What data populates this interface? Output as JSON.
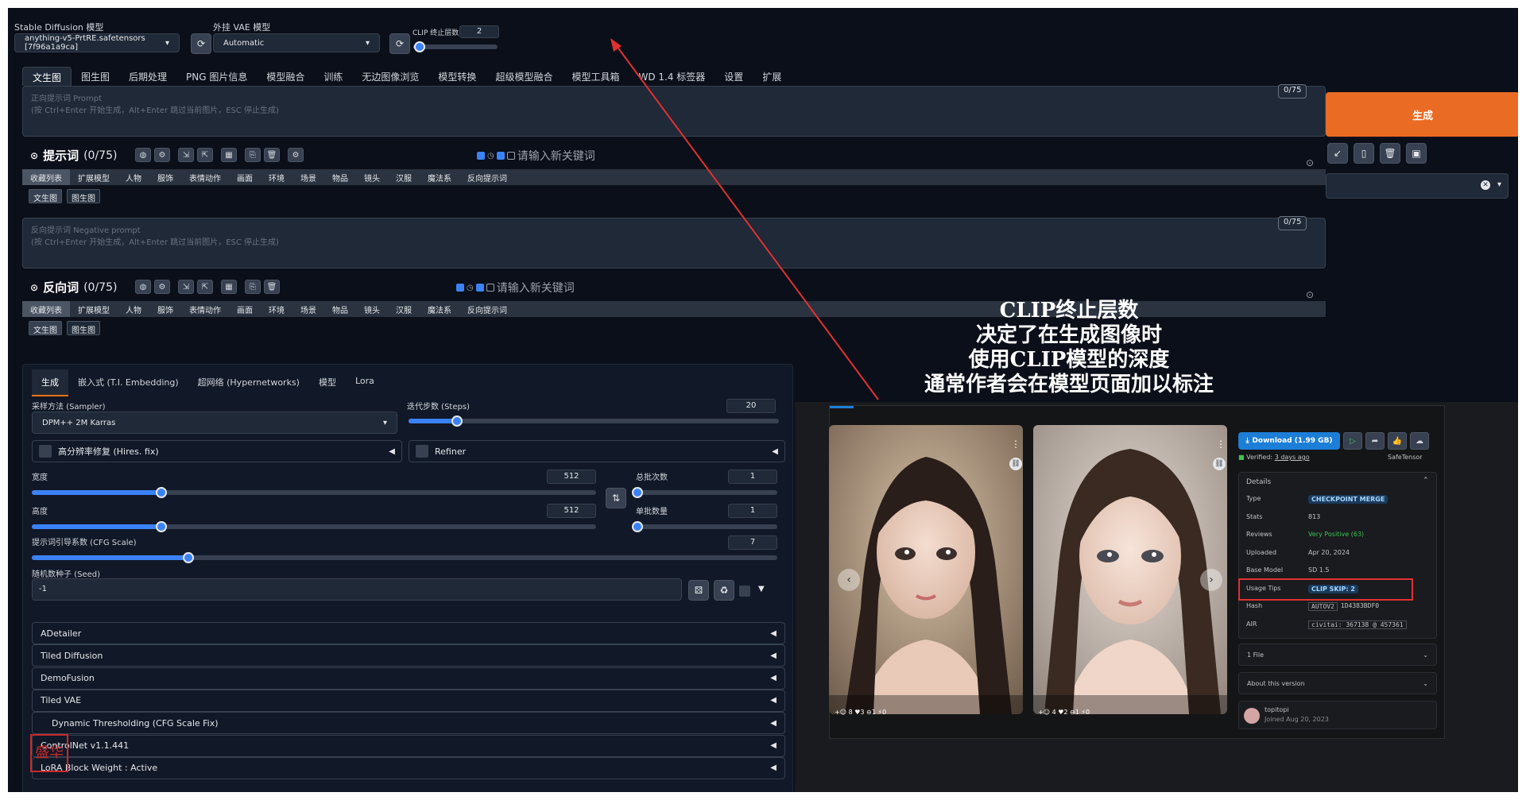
{
  "header": {
    "sd_model_label": "Stable Diffusion 模型",
    "sd_model_value": "anything-v5-PrtRE.safetensors [7f96a1a9ca]",
    "vae_label": "外挂 VAE 模型",
    "vae_value": "Automatic",
    "clip_label": "CLIP 终止层数",
    "clip_value": "2",
    "clip_fraction": 0.08
  },
  "main_tabs": [
    "文生图",
    "图生图",
    "后期处理",
    "PNG 图片信息",
    "模型融合",
    "训练",
    "无边图像浏览",
    "模型转换",
    "超级模型融合",
    "模型工具箱",
    "WD 1.4 标签器",
    "设置",
    "扩展"
  ],
  "prompt": {
    "placeholder_1": "正向提示词 Prompt",
    "placeholder_2": "(按 Ctrl+Enter 开始生成，Alt+Enter 跳过当前图片，ESC 停止生成)",
    "counter": "0/75",
    "section_title": "提示词",
    "section_count": "(0/75)",
    "keyword_placeholder": "请输入新关键词"
  },
  "negative": {
    "placeholder_1": "反向提示词 Negative prompt",
    "placeholder_2": "(按 Ctrl+Enter 开始生成，Alt+Enter 跳过当前图片，ESC 停止生成)",
    "counter": "0/75",
    "section_title": "反向词",
    "section_count": "(0/75)",
    "keyword_placeholder": "请输入新关键词"
  },
  "categories": [
    "收藏列表",
    "扩展模型",
    "人物",
    "服饰",
    "表情动作",
    "画面",
    "环境",
    "场景",
    "物品",
    "镜头",
    "汉服",
    "魔法系",
    "反向提示词"
  ],
  "sub_tabs": [
    "文生图",
    "图生图"
  ],
  "generate": {
    "label": "生成",
    "tools": [
      "↙",
      "▯",
      "🗑",
      "▣"
    ],
    "style_clear": "✕"
  },
  "gen_tabs": [
    "生成",
    "嵌入式 (T.I. Embedding)",
    "超网络 (Hypernetworks)",
    "模型",
    "Lora"
  ],
  "params": {
    "sampler_label": "采样方法 (Sampler)",
    "sampler_value": "DPM++ 2M Karras",
    "steps_label": "迭代步数 (Steps)",
    "steps_value": "20",
    "steps_fraction": 0.13,
    "hires_label": "高分辨率修复 (Hires. fix)",
    "refiner_label": "Refiner",
    "width_label": "宽度",
    "width_value": "512",
    "width_fraction": 0.23,
    "height_label": "高度",
    "height_value": "512",
    "height_fraction": 0.23,
    "batch_count_label": "总批次数",
    "batch_count_value": "1",
    "batch_count_fraction": 0.0,
    "batch_size_label": "单批数量",
    "batch_size_value": "1",
    "batch_size_fraction": 0.0,
    "cfg_label": "提示词引导系数 (CFG Scale)",
    "cfg_value": "7",
    "cfg_fraction": 0.21,
    "seed_label": "随机数种子 (Seed)",
    "seed_value": "-1"
  },
  "accordions": [
    "ADetailer",
    "Tiled Diffusion",
    "DemoFusion",
    "Tiled VAE",
    "Dynamic Thresholding (CFG Scale Fix)",
    "ControlNet v1.1.441",
    "LoRA Block Weight : Active"
  ],
  "annotation": [
    "CLIP终止层数",
    "决定了在生成图像时",
    "使用CLIP模型的深度",
    "通常作者会在模型页面加以标注"
  ],
  "civitai": {
    "download": "Download (1.99 GB)",
    "verified": "Verified:",
    "verified_when": "3 days ago",
    "safetensor": "SafeTensor",
    "details_title": "Details",
    "rows": [
      {
        "k": "Type",
        "v": "CHECKPOINT MERGE"
      },
      {
        "k": "Stats",
        "v": "813"
      },
      {
        "k": "Reviews",
        "v": "Very Positive (63)"
      },
      {
        "k": "Uploaded",
        "v": "Apr 20, 2024"
      },
      {
        "k": "Base Model",
        "v": "SD 1.5"
      },
      {
        "k": "Usage Tips",
        "v": "CLIP SKIP: 2"
      },
      {
        "k": "Hash",
        "v": "AUTOV2"
      },
      {
        "k": "AIR",
        "v": "civitai: 367138 @ 457361"
      }
    ],
    "hash_value": "1D4383BDF0",
    "files": "1 File",
    "about": "About this version",
    "author": "topitopi",
    "joined": "Joined Aug 20, 2023",
    "img1_stats": "+☺ 8 ♥3 ⊖1 ⚡0",
    "img2_stats": "+☺ 4 ♥2 ⊖1 ⚡0"
  },
  "colors": {
    "accent": "#ea6b24",
    "bg": "#0b0f19",
    "slider": "#3b82f6",
    "highlight": "#e03131",
    "arrow": "#e03131"
  },
  "watermark": "盛华"
}
